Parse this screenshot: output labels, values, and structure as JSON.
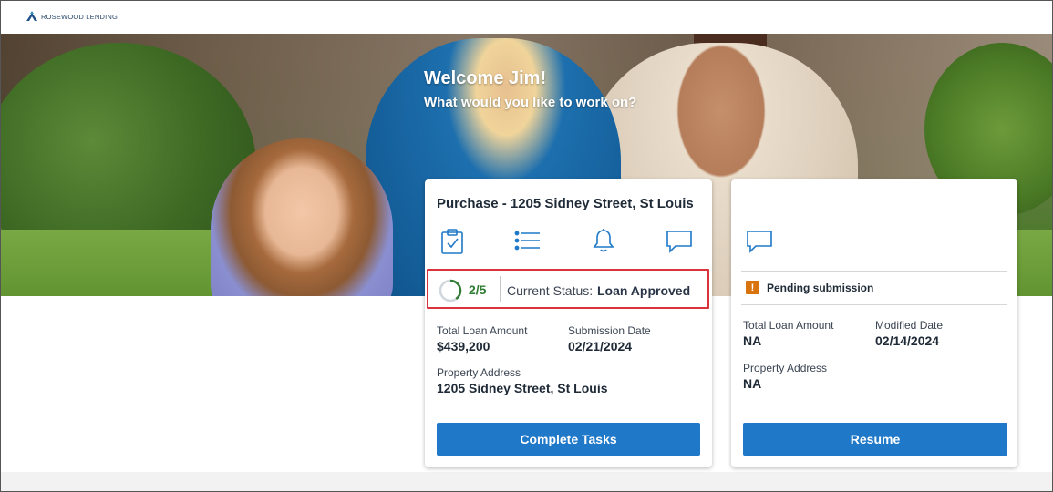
{
  "brand": {
    "name": "ROSEWOOD LENDING"
  },
  "hero": {
    "welcome": "Welcome Jim!",
    "subtitle": "What would you like to work on?"
  },
  "colors": {
    "accent": "#1f78c8",
    "progress": "#2e7d32",
    "highlight_border": "#d9343c",
    "warning": "#d9730d"
  },
  "cards": [
    {
      "title": "Purchase - 1205 Sidney Street, St Louis",
      "icons": [
        "clipboard-check-icon",
        "task-list-icon",
        "bell-icon",
        "chat-icon"
      ],
      "progress": {
        "text": "2/5",
        "done": 2,
        "total": 5
      },
      "status_label": "Current Status:",
      "status_value": "Loan Approved",
      "fields": {
        "amount_label": "Total Loan Amount",
        "amount_value": "$439,200",
        "date_label": "Submission Date",
        "date_value": "02/21/2024",
        "address_label": "Property Address",
        "address_value": "1205 Sidney Street, St Louis"
      },
      "button": "Complete Tasks"
    },
    {
      "title": "",
      "icons": [
        "chat-icon"
      ],
      "status_text": "Pending submission",
      "status_icon": "warning-icon",
      "status_icon_glyph": "!",
      "fields": {
        "amount_label": "Total Loan Amount",
        "amount_value": "NA",
        "date_label": "Modified Date",
        "date_value": "02/14/2024",
        "address_label": "Property Address",
        "address_value": "NA"
      },
      "button": "Resume"
    }
  ]
}
